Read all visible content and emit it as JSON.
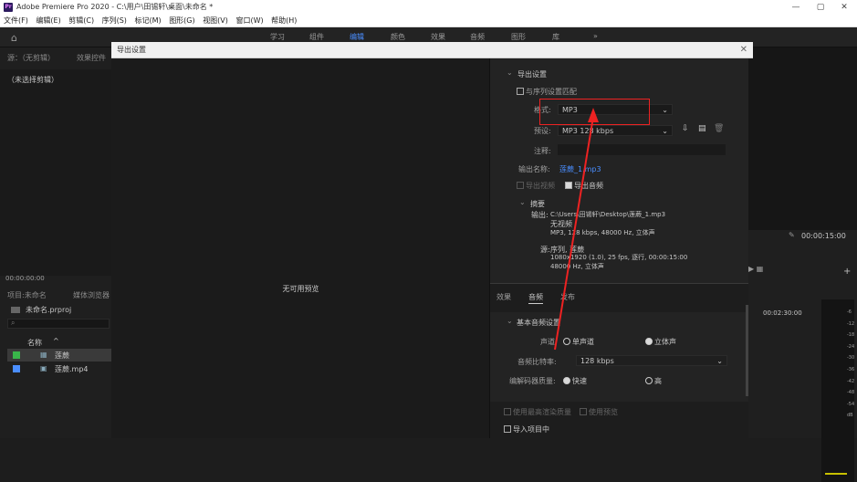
{
  "app": {
    "title": "Adobe Premiere Pro 2020 - C:\\用户\\田锡轩\\桌面\\未命名 *",
    "logo_text": "Pr",
    "window_controls": [
      "—",
      "▢",
      "✕"
    ]
  },
  "menu": [
    "文件(F)",
    "编辑(E)",
    "剪辑(C)",
    "序列(S)",
    "标记(M)",
    "图形(G)",
    "视图(V)",
    "窗口(W)",
    "帮助(H)"
  ],
  "workspaces": [
    "学习",
    "组件",
    "编辑",
    "颜色",
    "效果",
    "音频",
    "图形",
    "库",
    "»"
  ],
  "active_workspace": "编辑",
  "left_panel": {
    "tabs": [
      "源：（无剪辑）",
      "效果控件"
    ],
    "no_clip": "（未选择剪辑）",
    "timecode": "00:00:00:00",
    "project_tabs": [
      "项目:未命名",
      "媒体浏览器"
    ],
    "project_file": "未命名.prproj",
    "search_placeholder": "",
    "name_header": "名称",
    "items": [
      {
        "name": "莲蕨",
        "color": "#39b54a"
      },
      {
        "name": "莲蕨.mp4",
        "color": "#4a8eff"
      }
    ]
  },
  "right_bg": {
    "timecode": "00:00:15:00",
    "timeline_tc": "00:02:30:00",
    "db_labels": [
      "-6",
      "-12",
      "-18",
      "-24",
      "-30",
      "-36",
      "-42",
      "-48",
      "-54",
      "dB"
    ]
  },
  "dialog": {
    "title": "导出设置",
    "close": "✕",
    "no_preview": "无可用预览",
    "export_settings": {
      "header": "导出设置",
      "match_sequence": "与序列设置匹配",
      "format_label": "格式:",
      "format_value": "MP3",
      "preset_label": "预设:",
      "preset_value": "MP3 128 kbps",
      "comment_label": "注释:",
      "output_name_label": "输出名称:",
      "output_name_value": "莲蕨_1.mp3",
      "export_video": "导出视频",
      "export_audio": "导出音频"
    },
    "summary": {
      "header": "摘要",
      "output_label": "输出:",
      "output_path": "C:\\Users\\田锡轩\\Desktop\\莲蕨_1.mp3",
      "output_video": "无视频",
      "output_audio": "MP3, 128 kbps, 48000 Hz, 立体声",
      "source_label": "源:",
      "source_line1": "序列, 莲蕨",
      "source_line2": "1080x1920 (1.0), 25 fps, 逐行, 00:00:15:00",
      "source_line3": "48000 Hz, 立体声"
    },
    "tabs": [
      "效果",
      "音频",
      "发布"
    ],
    "active_tab": "音频",
    "audio": {
      "header": "基本音频设置",
      "channels_label": "声道:",
      "mono": "单声道",
      "stereo": "立体声",
      "bitrate_label": "音频比特率:",
      "bitrate_value": "128 kbps",
      "quality_label": "编解码器质量:",
      "fast": "快速",
      "high": "高"
    },
    "bottom": {
      "max_render": "使用最高渲染质量",
      "use_preview": "使用预览",
      "import_project": "导入项目中"
    }
  }
}
